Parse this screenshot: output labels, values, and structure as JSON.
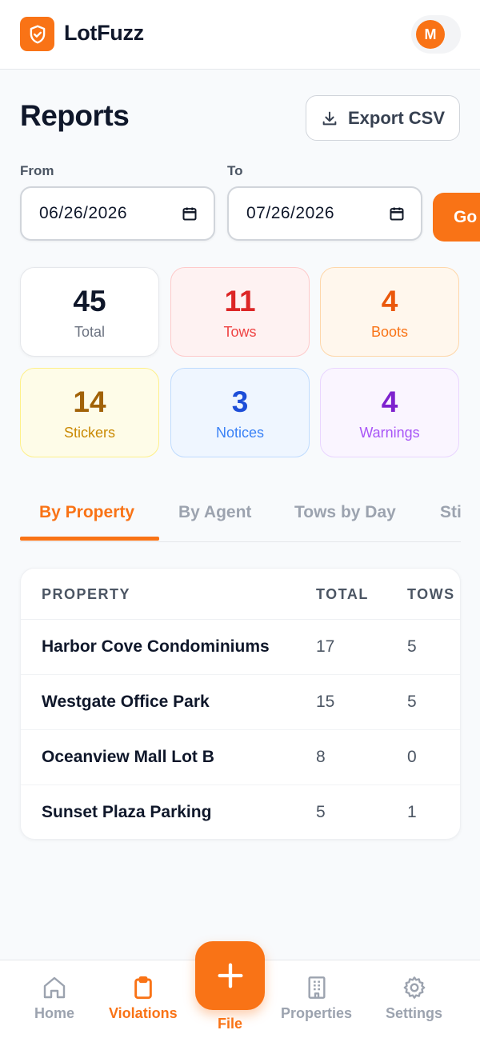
{
  "header": {
    "brand": "LotFuzz",
    "avatar_initial": "M",
    "logo_icon": "shield-icon",
    "accent": "#f97316"
  },
  "page": {
    "title": "Reports",
    "export_label": "Export CSV"
  },
  "filters": {
    "from_label": "From",
    "from_value": "06/26/2026",
    "to_label": "To",
    "to_value": "07/26/2026",
    "go_label": "Go"
  },
  "stats": [
    {
      "value": "45",
      "label": "Total"
    },
    {
      "value": "11",
      "label": "Tows"
    },
    {
      "value": "4",
      "label": "Boots"
    },
    {
      "value": "14",
      "label": "Stickers"
    },
    {
      "value": "3",
      "label": "Notices"
    },
    {
      "value": "4",
      "label": "Warnings"
    }
  ],
  "tabs": [
    {
      "label": "By Property",
      "active": true
    },
    {
      "label": "By Agent"
    },
    {
      "label": "Tows by Day"
    },
    {
      "label": "Sti"
    }
  ],
  "table": {
    "headers": [
      "PROPERTY",
      "TOTAL",
      "TOWS"
    ],
    "rows": [
      {
        "property": "Harbor Cove Condominiums",
        "total": "17",
        "tows": "5"
      },
      {
        "property": "Westgate Office Park",
        "total": "15",
        "tows": "5"
      },
      {
        "property": "Oceanview Mall Lot B",
        "total": "8",
        "tows": "0"
      },
      {
        "property": "Sunset Plaza Parking",
        "total": "5",
        "tows": "1"
      }
    ]
  },
  "nav": {
    "home": "Home",
    "violations": "Violations",
    "file": "File",
    "properties": "Properties",
    "settings": "Settings"
  }
}
